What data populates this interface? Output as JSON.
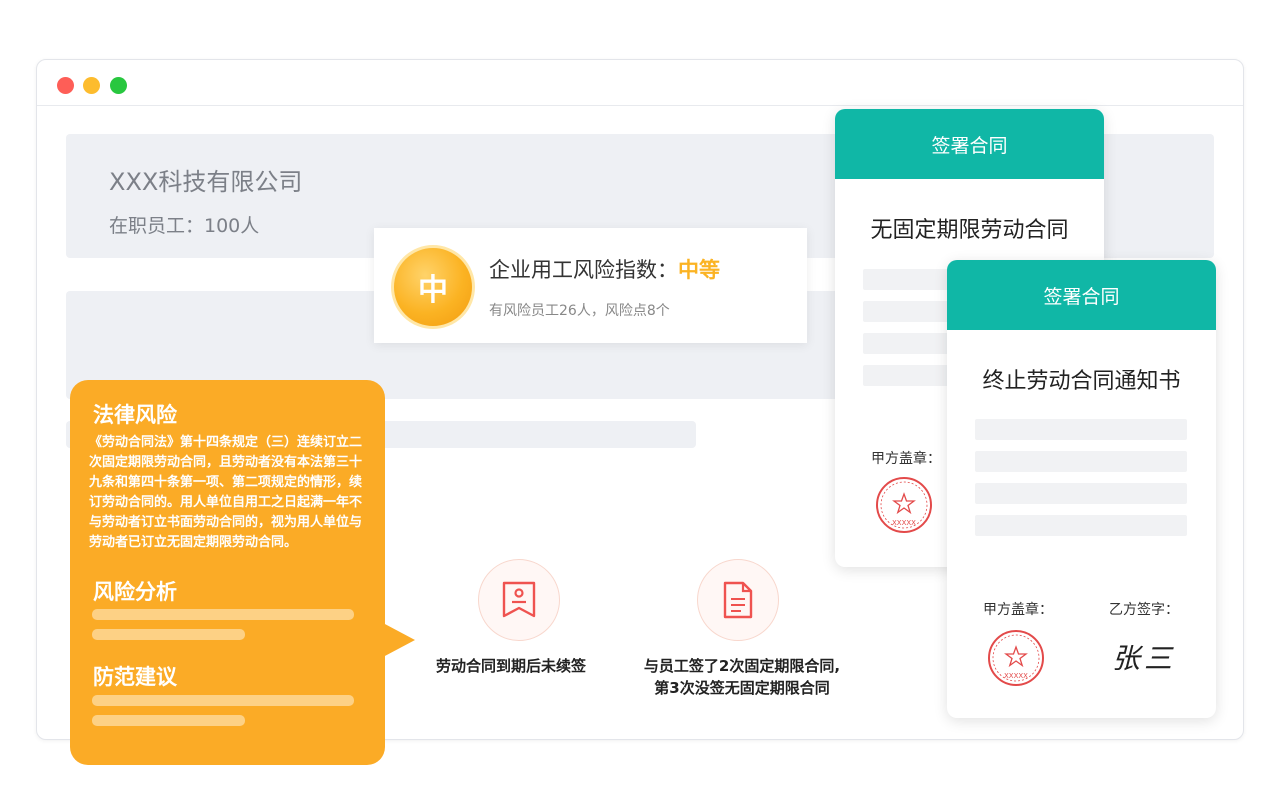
{
  "company": {
    "name": "XXX科技有限公司",
    "staff": "在职员工：100人"
  },
  "risk": {
    "medal": "中",
    "title_prefix": "企业用工风险指数：",
    "level": "中等",
    "summary": "有风险员工26人，风险点8个"
  },
  "legal": {
    "title": "法律风险",
    "text": "《劳动合同法》第十四条规定（三）连续订立二次固定期限劳动合同，且劳动者没有本法第三十九条和第四十条第一项、第二项规定的情形，续订劳动合同的。用人单位自用工之日起满一年不与劳动者订立书面劳动合同的，视为用人单位与劳动者已订立无固定期限劳动合同。",
    "analysis_title": "风险分析",
    "advice_title": "防范建议"
  },
  "issues": [
    {
      "label": "劳动合同到期后未续签",
      "icon": "bookmark-badge-icon"
    },
    {
      "label_line1": "与员工签了2次固定期限合同,",
      "label_line2": "第3次没签无固定期限合同",
      "icon": "document-icon"
    }
  ],
  "contracts": [
    {
      "header": "签署合同",
      "title": "无固定期限劳动合同",
      "party_a": "甲方盖章："
    },
    {
      "header": "签署合同",
      "title": "终止劳动合同通知书",
      "party_a": "甲方盖章：",
      "party_b": "乙方签字：",
      "signature": "张三"
    }
  ],
  "seal_text": "XXXXX",
  "colors": {
    "accent_orange": "#fbab26",
    "teal": "#10b7a6",
    "seal_red": "#e34a4a"
  }
}
